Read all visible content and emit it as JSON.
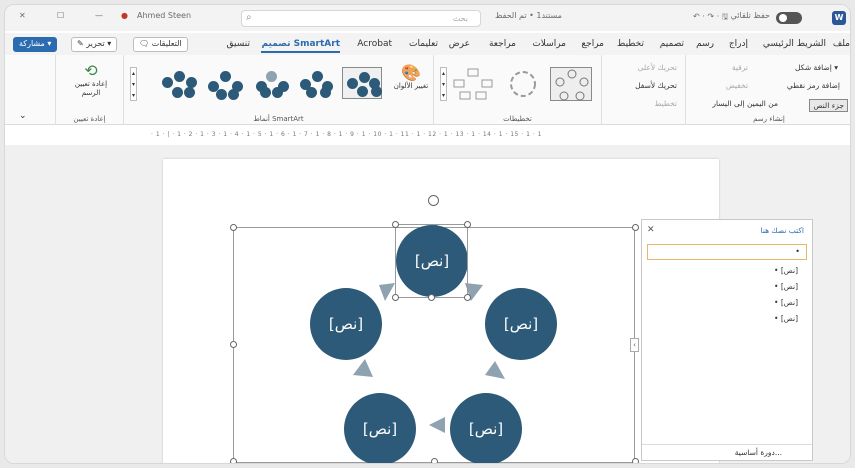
{
  "titlebar": {
    "autosave": "حفظ تلقائي",
    "doc_title": "مستند1 • تم الحفظ",
    "search_placeholder": "بحث",
    "user": "Ahmed Steen"
  },
  "tabs": [
    "ملف",
    "الشريط الرئيسي",
    "إدراج",
    "رسم",
    "تصميم",
    "تخطيط",
    "مراجع",
    "مراسلات",
    "مراجعة",
    "عرض",
    "تعليمات",
    "Acrobat",
    "تصميم SmartArt",
    "تنسيق"
  ],
  "menu_buttons": {
    "comments": "التعليقات",
    "edit": "تحرير",
    "share": "مشاركة"
  },
  "ribbon": {
    "create_graphic": {
      "label": "إنشاء رسم",
      "add_shape": "إضافة شكل",
      "add_bullet": "إضافة رمز نقطي",
      "text_pane": "جزء النص",
      "promote": "ترقية",
      "demote": "تخفيض",
      "rtl": "من اليمين إلى اليسار",
      "move_up": "تحريك لأعلى",
      "move_down": "تحريك لأسفل",
      "layout": "تخطيط"
    },
    "layouts": {
      "label": "تخطيطات"
    },
    "styles": {
      "label": "أنماط SmartArt",
      "change_colors": "تغيير الألوان"
    },
    "reset": {
      "label": "إعادة تعيين",
      "reset_graphic": "إعادة تعيين الرسم"
    }
  },
  "ruler": "· 1 · | · 1 · 2 · 1 · 3 · 1 · 4 · 1 · 5 · 1 · 6 · 1 · 7 · 1 · 8 · 1 · 9 · 1 · 10 · 1 · 11 · 1 · 12 · 1 · 13 · 1 · 14 · 1 · 15 · 1 · 1",
  "smartart": {
    "nodes": [
      "[نص]",
      "[نص]",
      "[نص]",
      "[نص]",
      "[نص]"
    ],
    "fill_color": "#2c5a78",
    "arrow_color": "#8fa2b0"
  },
  "text_pane": {
    "title": "اكتب نصك هنا",
    "items": [
      "[نص]",
      "[نص]",
      "[نص]",
      "[نص]"
    ],
    "footer": "دورة أساسية..."
  }
}
